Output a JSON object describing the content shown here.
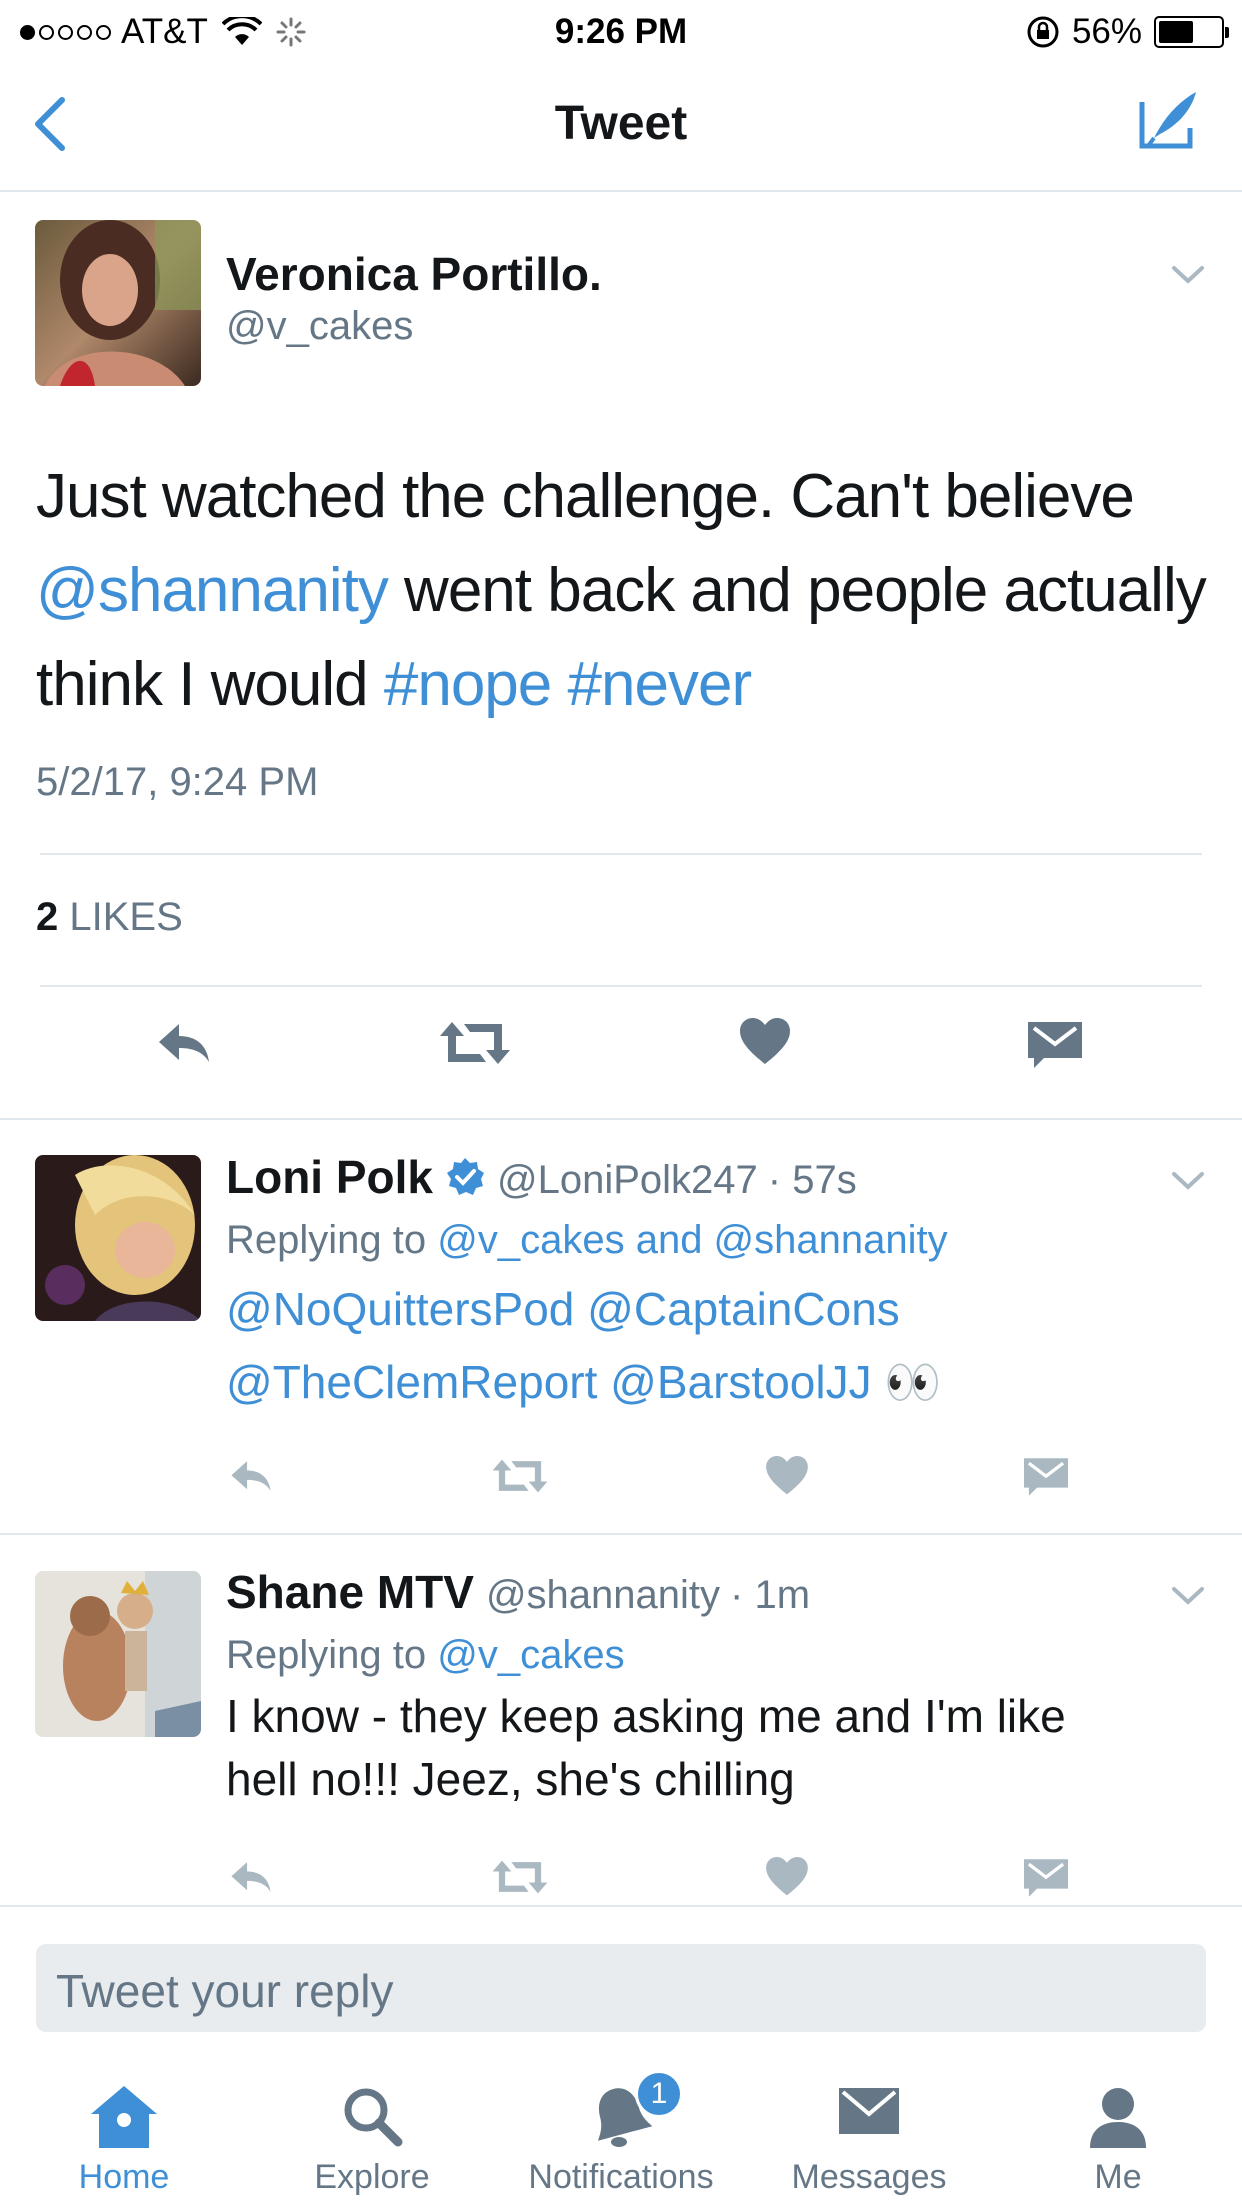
{
  "status_bar": {
    "carrier": "AT&T",
    "time": "9:26 PM",
    "battery": "56%",
    "battery_level": 0.56,
    "signal_bars": 1
  },
  "nav": {
    "title": "Tweet",
    "back_icon": "chevron-left-icon",
    "compose_icon": "compose-tweet-icon"
  },
  "main_tweet": {
    "name": "Veronica Portillo.",
    "handle": "@v_cakes",
    "text_1": "Just watched the challenge.  Can't believe ",
    "mention": "@shannanity",
    "text_2": " went back and people actually think I would ",
    "hashtag_1": "#nope",
    "hashtag_2": "#never",
    "timestamp": "5/2/17, 9:24 PM",
    "likes_count": "2",
    "likes_label": "LIKES"
  },
  "replies": [
    {
      "name": "Loni Polk",
      "verified": true,
      "handle": "@LoniPolk247",
      "time": "· 57s",
      "replying_prefix": "Replying to",
      "replying_to": "@v_cakes and @shannanity",
      "body_line_1": "@NoQuittersPod @CaptainCons",
      "body_line_2": "@TheClemReport @BarstoolJJ",
      "body_emoji": "👀"
    },
    {
      "name": "Shane MTV",
      "verified": false,
      "handle": "@shannanity",
      "time": "· 1m",
      "replying_prefix": "Replying to",
      "replying_to": "@v_cakes",
      "body_line_1": "I know - they keep asking me and I'm like",
      "body_line_2": "hell no!!! Jeez, she's chilling"
    }
  ],
  "reply_input": {
    "placeholder": "Tweet your reply"
  },
  "tab_bar": {
    "items": [
      {
        "label": "Home",
        "icon": "home-icon",
        "active": true
      },
      {
        "label": "Explore",
        "icon": "search-icon",
        "active": false
      },
      {
        "label": "Notifications",
        "icon": "bell-icon",
        "active": false,
        "badge": "1"
      },
      {
        "label": "Messages",
        "icon": "envelope-icon",
        "active": false
      },
      {
        "label": "Me",
        "icon": "person-icon",
        "active": false
      }
    ]
  },
  "colors": {
    "accent": "#3f8fd6",
    "text": "#14171a",
    "secondary": "#657786",
    "divider": "#e1e8ed"
  }
}
